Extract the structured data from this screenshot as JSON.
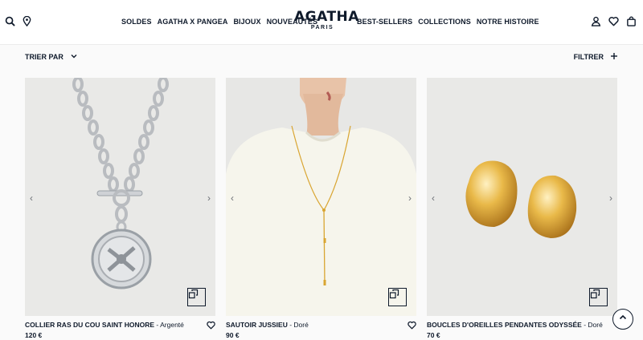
{
  "header": {
    "nav_left": [
      "SOLDES",
      "AGATHA X PANGEA",
      "BIJOUX",
      "NOUVEAUTÉS"
    ],
    "nav_right": [
      "BEST-SELLERS",
      "COLLECTIONS",
      "NOTRE HISTOIRE"
    ],
    "logo": {
      "main": "AGATHA",
      "sub": "PARIS"
    },
    "icons_left": [
      "search-icon",
      "location-pin-icon"
    ],
    "icons_right": [
      "account-icon",
      "wishlist-heart-icon",
      "bag-icon"
    ]
  },
  "toolbar": {
    "sort_label": "TRIER PAR",
    "filter_label": "FILTRER"
  },
  "products": [
    {
      "name": "COLLIER RAS DU COU SAINT HONORE",
      "variant": " - Argenté",
      "price": "120 €"
    },
    {
      "name": "SAUTOIR JUSSIEU",
      "variant": " - Doré",
      "price": "90 €"
    },
    {
      "name": "BOUCLES D'OREILLES PENDANTES ODYSSÉE",
      "variant": " - Doré",
      "price": "70 €"
    }
  ],
  "colors": {
    "brand_navy": "#0f1a2b",
    "image_bg": "#e9e9e7",
    "gold": "#d9a531",
    "silver": "#cfd2d6"
  }
}
